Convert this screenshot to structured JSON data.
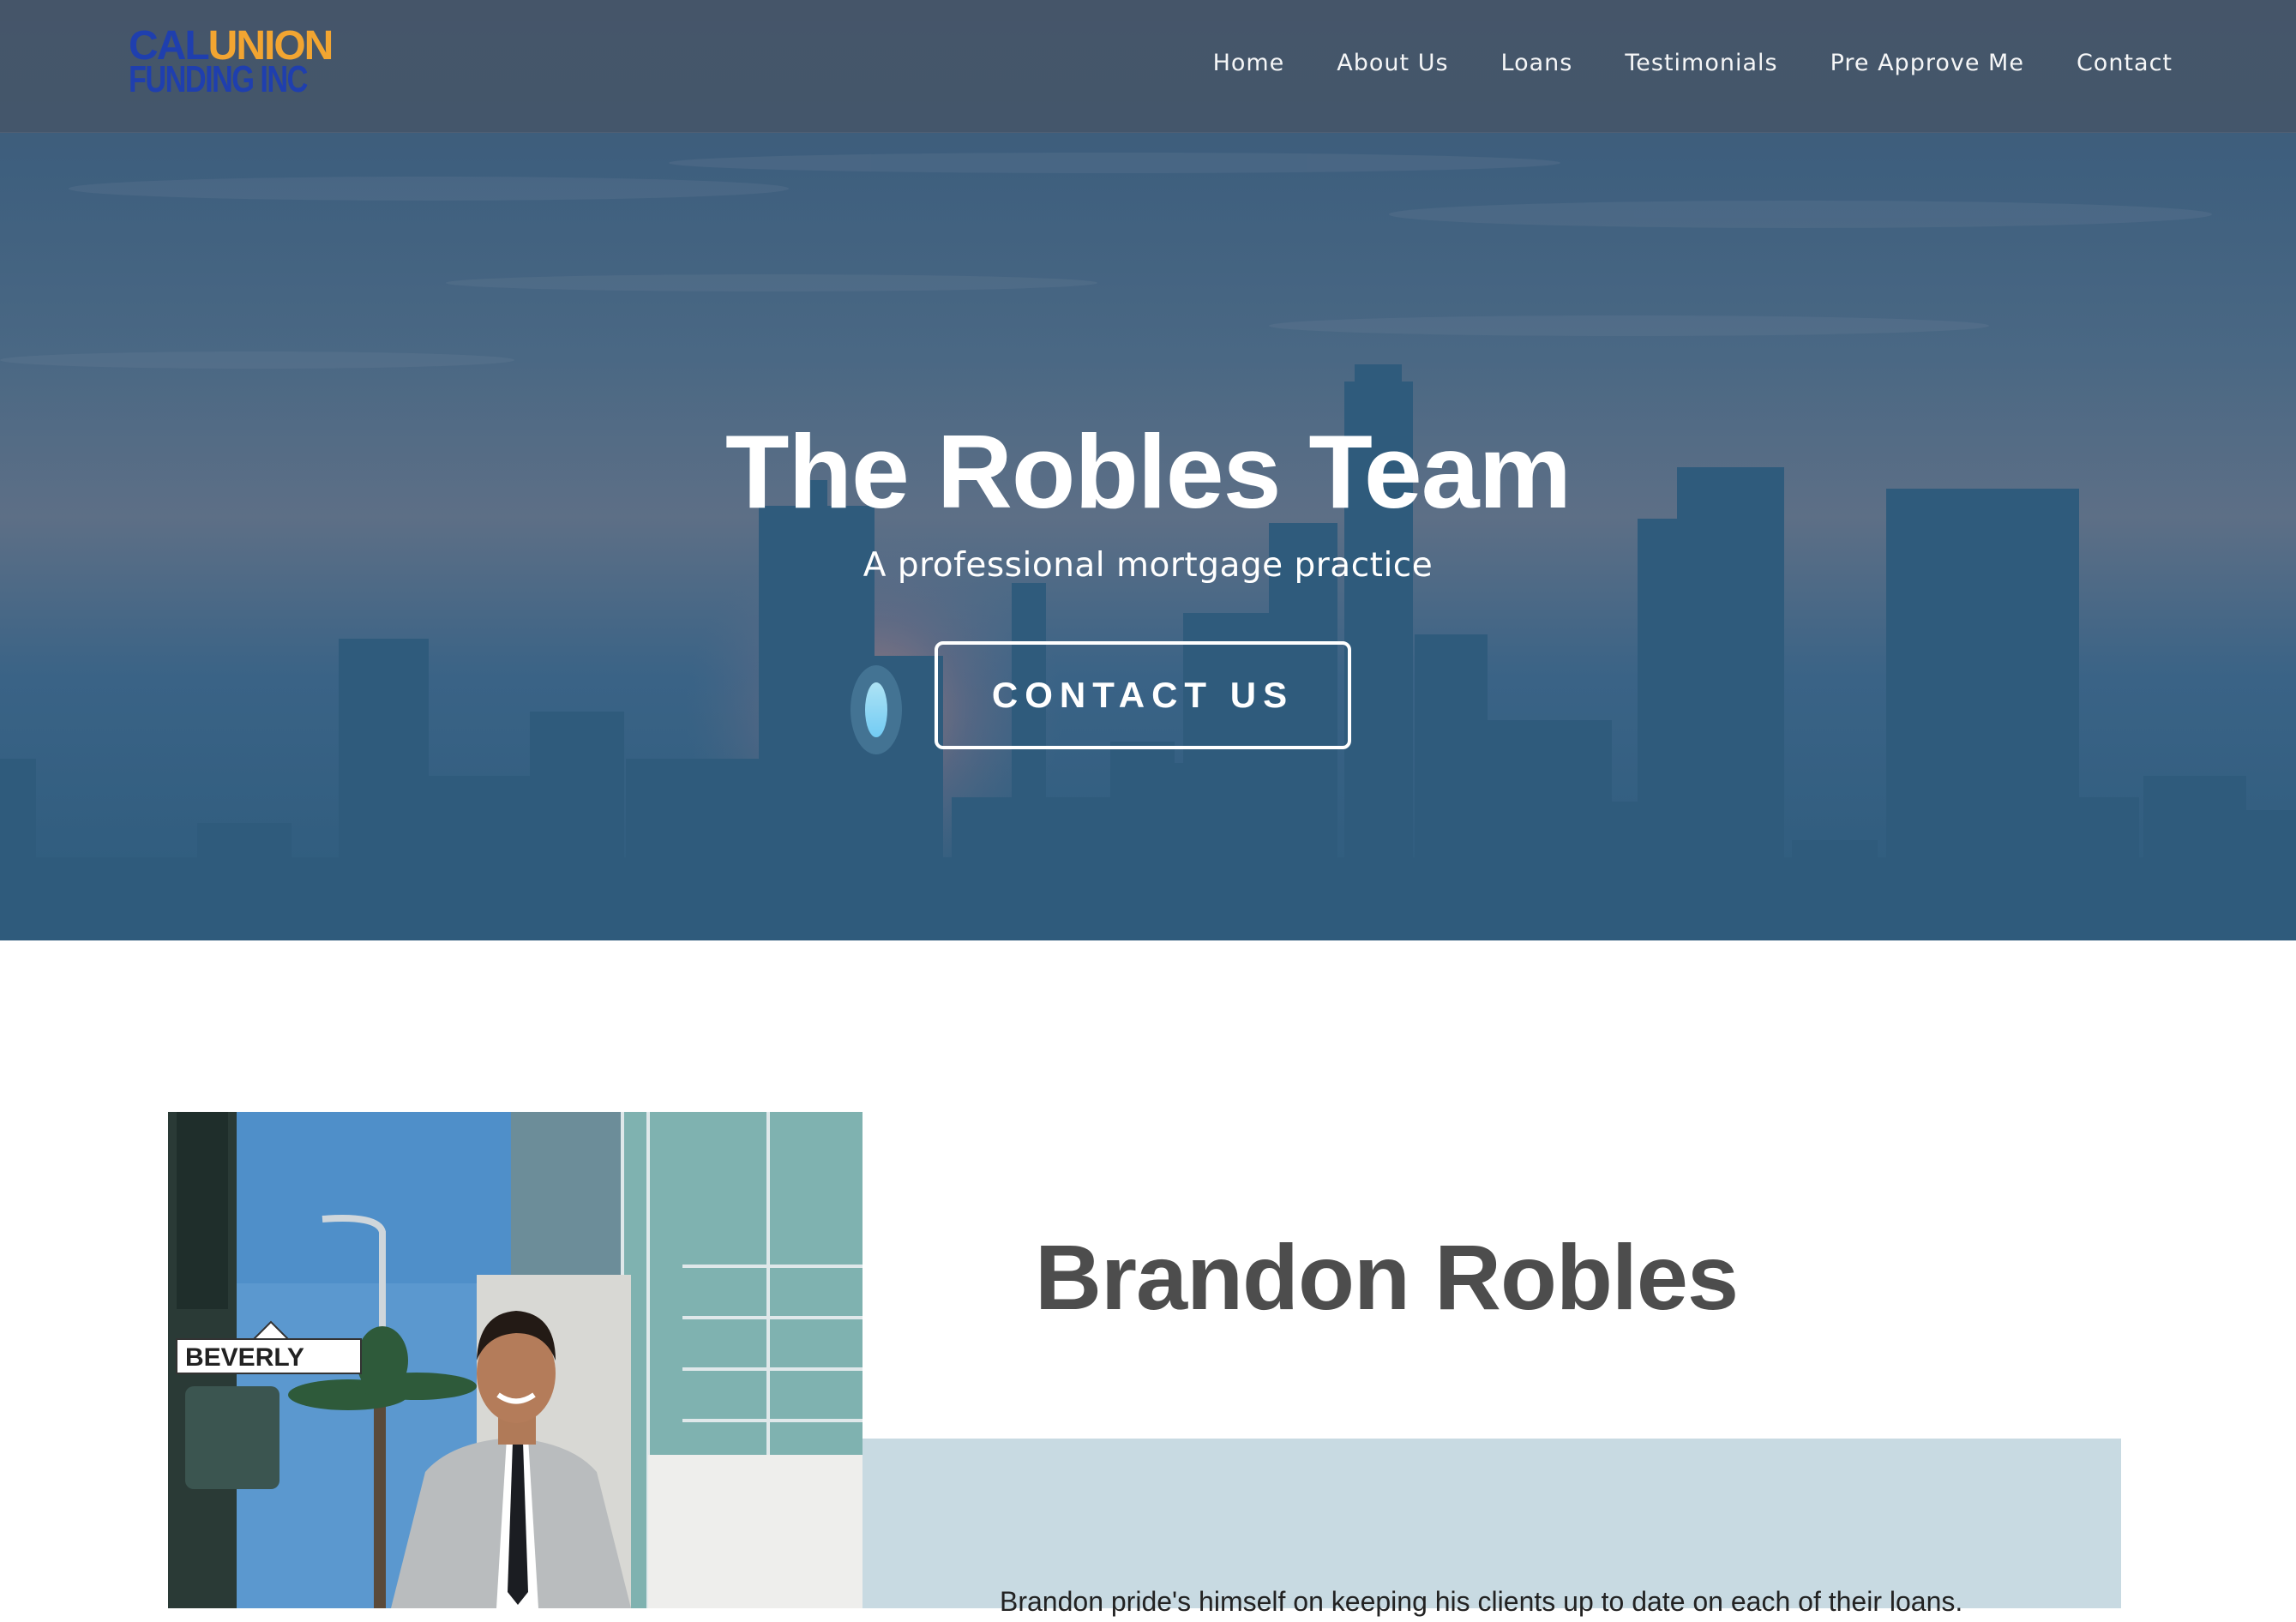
{
  "brand": {
    "logo_line1_cal": "CAL",
    "logo_line1_union": "UNION",
    "logo_line2": "FUNDING INC",
    "colors": {
      "logo_blue": "#1f3fae",
      "logo_orange": "#f2a531"
    }
  },
  "nav": {
    "items": [
      {
        "label": "Home"
      },
      {
        "label": "About Us"
      },
      {
        "label": "Loans"
      },
      {
        "label": "Testimonials"
      },
      {
        "label": "Pre Approve Me"
      },
      {
        "label": "Contact"
      }
    ]
  },
  "hero": {
    "title": "The Robles Team",
    "subtitle": "A professional mortgage practice",
    "cta_label": "CONTACT US",
    "background": "city skyline at dusk with blue overlay"
  },
  "profile": {
    "name": "Brandon Robles",
    "street_sign": "BEVERLY",
    "bio_excerpt": "Brandon pride's himself on keeping his clients up to date on each of their loans.",
    "panel_color": "#c8dae2"
  }
}
